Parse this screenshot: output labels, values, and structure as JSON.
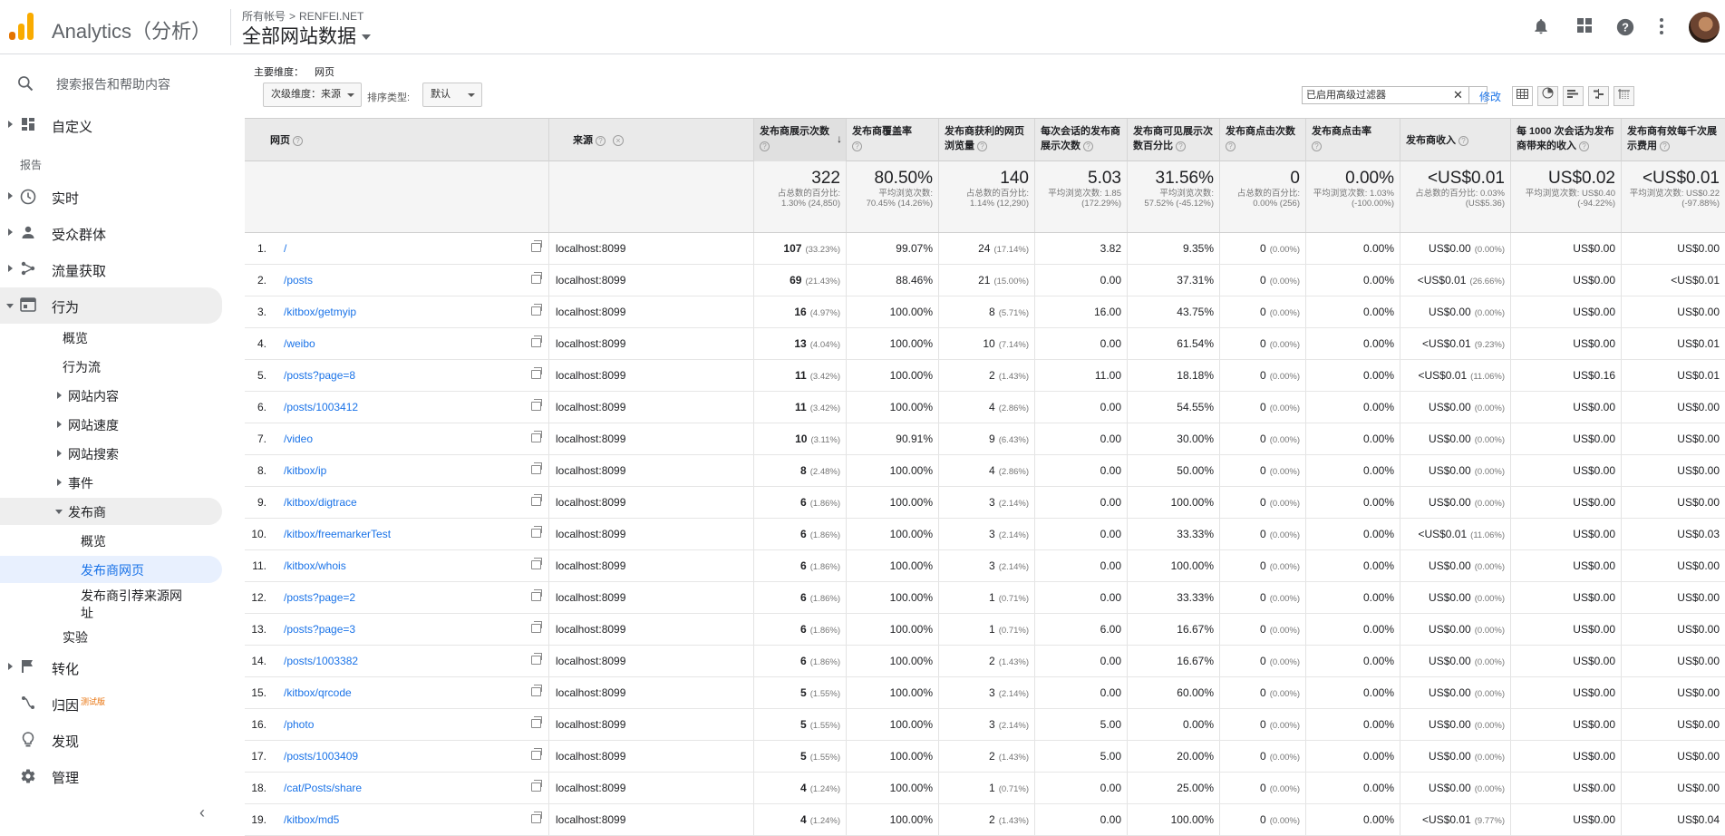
{
  "app": {
    "title": "Analytics（分析）"
  },
  "account": {
    "crumb_root": "所有帐号",
    "crumb_sep": ">",
    "crumb_account": "RENFEI.NET",
    "property": "全部网站数据"
  },
  "sidebar": {
    "search_placeholder": "搜索报告和帮助内容",
    "custom": "自定义",
    "reports_label": "报告",
    "realtime": "实时",
    "audience": "受众群体",
    "acquisition": "流量获取",
    "behavior": "行为",
    "overview": "概览",
    "flow": "行为流",
    "content": "网站内容",
    "speed": "网站速度",
    "search": "网站搜索",
    "events": "事件",
    "publisher": "发布商",
    "pub_overview": "概览",
    "pub_pages": "发布商网页",
    "pub_referrers": "发布商引荐来源网址",
    "experiments": "实验",
    "conversions": "转化",
    "attribution": "归因",
    "attribution_beta": "测试版",
    "discover": "发现",
    "admin": "管理"
  },
  "main": {
    "primary_dim_label": "主要维度：",
    "primary_dim_value": "网页",
    "secondary_dim": "次级维度：来源",
    "sort_type_label": "排序类型:",
    "sort_type_value": "默认",
    "filter_text": "已启用高级过滤器",
    "filter_clear": "✕",
    "modify": "修改"
  },
  "table": {
    "headers": {
      "page": "网页",
      "source": "来源",
      "impressions": "发布商展示次数",
      "coverage": "发布商覆盖率",
      "monetized": "发布商获利的网页浏览量",
      "imp_per_session": "每次会话的发布商展示次数",
      "viewable": "发布商可见展示次数百分比",
      "clicks": "发布商点击次数",
      "ctr": "发布商点击率",
      "revenue": "发布商收入",
      "rev_per_1000": "每 1000 次会话为发布商带来的收入",
      "ecpm": "发布商有效每千次展示费用"
    },
    "totals": {
      "impressions": "322",
      "impressions_sub": "占总数的百分比: 1.30% (24,850)",
      "coverage": "80.50%",
      "coverage_sub": "平均浏览次数: 70.45% (14.26%)",
      "monetized": "140",
      "monetized_sub": "占总数的百分比: 1.14% (12,290)",
      "imp_per_session": "5.03",
      "imp_per_session_sub": "平均浏览次数: 1.85 (172.29%)",
      "viewable": "31.56%",
      "viewable_sub": "平均浏览次数: 57.52% (-45.12%)",
      "clicks": "0",
      "clicks_sub": "占总数的百分比: 0.00% (256)",
      "ctr": "0.00%",
      "ctr_sub": "平均浏览次数: 1.03% (-100.00%)",
      "revenue": "<US$0.01",
      "revenue_sub": "占总数的百分比: 0.03% (US$5.36)",
      "rev_per_1000": "US$0.02",
      "rev_per_1000_sub": "平均浏览次数: US$0.40 (-94.22%)",
      "ecpm": "<US$0.01",
      "ecpm_sub": "平均浏览次数: US$0.22 (-97.88%)"
    },
    "rows": [
      {
        "idx": "1.",
        "page": "/",
        "source": "localhost:8099",
        "imp": "107",
        "imp_pct": "(33.23%)",
        "cov": "99.07%",
        "mon": "24",
        "mon_pct": "(17.14%)",
        "ips": "3.82",
        "view": "9.35%",
        "clk": "0",
        "clk_pct": "(0.00%)",
        "ctr": "0.00%",
        "rev": "US$0.00",
        "rev_pct": "(0.00%)",
        "r1000": "US$0.00",
        "ecpm": "US$0.00"
      },
      {
        "idx": "2.",
        "page": "/posts",
        "source": "localhost:8099",
        "imp": "69",
        "imp_pct": "(21.43%)",
        "cov": "88.46%",
        "mon": "21",
        "mon_pct": "(15.00%)",
        "ips": "0.00",
        "view": "37.31%",
        "clk": "0",
        "clk_pct": "(0.00%)",
        "ctr": "0.00%",
        "rev": "<US$0.01",
        "rev_pct": "(26.66%)",
        "r1000": "US$0.00",
        "ecpm": "<US$0.01"
      },
      {
        "idx": "3.",
        "page": "/kitbox/getmyip",
        "source": "localhost:8099",
        "imp": "16",
        "imp_pct": "(4.97%)",
        "cov": "100.00%",
        "mon": "8",
        "mon_pct": "(5.71%)",
        "ips": "16.00",
        "view": "43.75%",
        "clk": "0",
        "clk_pct": "(0.00%)",
        "ctr": "0.00%",
        "rev": "US$0.00",
        "rev_pct": "(0.00%)",
        "r1000": "US$0.00",
        "ecpm": "US$0.00"
      },
      {
        "idx": "4.",
        "page": "/weibo",
        "source": "localhost:8099",
        "imp": "13",
        "imp_pct": "(4.04%)",
        "cov": "100.00%",
        "mon": "10",
        "mon_pct": "(7.14%)",
        "ips": "0.00",
        "view": "61.54%",
        "clk": "0",
        "clk_pct": "(0.00%)",
        "ctr": "0.00%",
        "rev": "<US$0.01",
        "rev_pct": "(9.23%)",
        "r1000": "US$0.00",
        "ecpm": "US$0.01"
      },
      {
        "idx": "5.",
        "page": "/posts?page=8",
        "source": "localhost:8099",
        "imp": "11",
        "imp_pct": "(3.42%)",
        "cov": "100.00%",
        "mon": "2",
        "mon_pct": "(1.43%)",
        "ips": "11.00",
        "view": "18.18%",
        "clk": "0",
        "clk_pct": "(0.00%)",
        "ctr": "0.00%",
        "rev": "<US$0.01",
        "rev_pct": "(11.06%)",
        "r1000": "US$0.16",
        "ecpm": "US$0.01"
      },
      {
        "idx": "6.",
        "page": "/posts/1003412",
        "source": "localhost:8099",
        "imp": "11",
        "imp_pct": "(3.42%)",
        "cov": "100.00%",
        "mon": "4",
        "mon_pct": "(2.86%)",
        "ips": "0.00",
        "view": "54.55%",
        "clk": "0",
        "clk_pct": "(0.00%)",
        "ctr": "0.00%",
        "rev": "US$0.00",
        "rev_pct": "(0.00%)",
        "r1000": "US$0.00",
        "ecpm": "US$0.00"
      },
      {
        "idx": "7.",
        "page": "/video",
        "source": "localhost:8099",
        "imp": "10",
        "imp_pct": "(3.11%)",
        "cov": "90.91%",
        "mon": "9",
        "mon_pct": "(6.43%)",
        "ips": "0.00",
        "view": "30.00%",
        "clk": "0",
        "clk_pct": "(0.00%)",
        "ctr": "0.00%",
        "rev": "US$0.00",
        "rev_pct": "(0.00%)",
        "r1000": "US$0.00",
        "ecpm": "US$0.00"
      },
      {
        "idx": "8.",
        "page": "/kitbox/ip",
        "source": "localhost:8099",
        "imp": "8",
        "imp_pct": "(2.48%)",
        "cov": "100.00%",
        "mon": "4",
        "mon_pct": "(2.86%)",
        "ips": "0.00",
        "view": "50.00%",
        "clk": "0",
        "clk_pct": "(0.00%)",
        "ctr": "0.00%",
        "rev": "US$0.00",
        "rev_pct": "(0.00%)",
        "r1000": "US$0.00",
        "ecpm": "US$0.00"
      },
      {
        "idx": "9.",
        "page": "/kitbox/digtrace",
        "source": "localhost:8099",
        "imp": "6",
        "imp_pct": "(1.86%)",
        "cov": "100.00%",
        "mon": "3",
        "mon_pct": "(2.14%)",
        "ips": "0.00",
        "view": "100.00%",
        "clk": "0",
        "clk_pct": "(0.00%)",
        "ctr": "0.00%",
        "rev": "US$0.00",
        "rev_pct": "(0.00%)",
        "r1000": "US$0.00",
        "ecpm": "US$0.00"
      },
      {
        "idx": "10.",
        "page": "/kitbox/freemarkerTest",
        "source": "localhost:8099",
        "imp": "6",
        "imp_pct": "(1.86%)",
        "cov": "100.00%",
        "mon": "3",
        "mon_pct": "(2.14%)",
        "ips": "0.00",
        "view": "33.33%",
        "clk": "0",
        "clk_pct": "(0.00%)",
        "ctr": "0.00%",
        "rev": "<US$0.01",
        "rev_pct": "(11.06%)",
        "r1000": "US$0.00",
        "ecpm": "US$0.03"
      },
      {
        "idx": "11.",
        "page": "/kitbox/whois",
        "source": "localhost:8099",
        "imp": "6",
        "imp_pct": "(1.86%)",
        "cov": "100.00%",
        "mon": "3",
        "mon_pct": "(2.14%)",
        "ips": "0.00",
        "view": "100.00%",
        "clk": "0",
        "clk_pct": "(0.00%)",
        "ctr": "0.00%",
        "rev": "US$0.00",
        "rev_pct": "(0.00%)",
        "r1000": "US$0.00",
        "ecpm": "US$0.00"
      },
      {
        "idx": "12.",
        "page": "/posts?page=2",
        "source": "localhost:8099",
        "imp": "6",
        "imp_pct": "(1.86%)",
        "cov": "100.00%",
        "mon": "1",
        "mon_pct": "(0.71%)",
        "ips": "0.00",
        "view": "33.33%",
        "clk": "0",
        "clk_pct": "(0.00%)",
        "ctr": "0.00%",
        "rev": "US$0.00",
        "rev_pct": "(0.00%)",
        "r1000": "US$0.00",
        "ecpm": "US$0.00"
      },
      {
        "idx": "13.",
        "page": "/posts?page=3",
        "source": "localhost:8099",
        "imp": "6",
        "imp_pct": "(1.86%)",
        "cov": "100.00%",
        "mon": "1",
        "mon_pct": "(0.71%)",
        "ips": "6.00",
        "view": "16.67%",
        "clk": "0",
        "clk_pct": "(0.00%)",
        "ctr": "0.00%",
        "rev": "US$0.00",
        "rev_pct": "(0.00%)",
        "r1000": "US$0.00",
        "ecpm": "US$0.00"
      },
      {
        "idx": "14.",
        "page": "/posts/1003382",
        "source": "localhost:8099",
        "imp": "6",
        "imp_pct": "(1.86%)",
        "cov": "100.00%",
        "mon": "2",
        "mon_pct": "(1.43%)",
        "ips": "0.00",
        "view": "16.67%",
        "clk": "0",
        "clk_pct": "(0.00%)",
        "ctr": "0.00%",
        "rev": "US$0.00",
        "rev_pct": "(0.00%)",
        "r1000": "US$0.00",
        "ecpm": "US$0.00"
      },
      {
        "idx": "15.",
        "page": "/kitbox/qrcode",
        "source": "localhost:8099",
        "imp": "5",
        "imp_pct": "(1.55%)",
        "cov": "100.00%",
        "mon": "3",
        "mon_pct": "(2.14%)",
        "ips": "0.00",
        "view": "60.00%",
        "clk": "0",
        "clk_pct": "(0.00%)",
        "ctr": "0.00%",
        "rev": "US$0.00",
        "rev_pct": "(0.00%)",
        "r1000": "US$0.00",
        "ecpm": "US$0.00"
      },
      {
        "idx": "16.",
        "page": "/photo",
        "source": "localhost:8099",
        "imp": "5",
        "imp_pct": "(1.55%)",
        "cov": "100.00%",
        "mon": "3",
        "mon_pct": "(2.14%)",
        "ips": "5.00",
        "view": "0.00%",
        "clk": "0",
        "clk_pct": "(0.00%)",
        "ctr": "0.00%",
        "rev": "US$0.00",
        "rev_pct": "(0.00%)",
        "r1000": "US$0.00",
        "ecpm": "US$0.00"
      },
      {
        "idx": "17.",
        "page": "/posts/1003409",
        "source": "localhost:8099",
        "imp": "5",
        "imp_pct": "(1.55%)",
        "cov": "100.00%",
        "mon": "2",
        "mon_pct": "(1.43%)",
        "ips": "5.00",
        "view": "20.00%",
        "clk": "0",
        "clk_pct": "(0.00%)",
        "ctr": "0.00%",
        "rev": "US$0.00",
        "rev_pct": "(0.00%)",
        "r1000": "US$0.00",
        "ecpm": "US$0.00"
      },
      {
        "idx": "18.",
        "page": "/cat/Posts/share",
        "source": "localhost:8099",
        "imp": "4",
        "imp_pct": "(1.24%)",
        "cov": "100.00%",
        "mon": "1",
        "mon_pct": "(0.71%)",
        "ips": "0.00",
        "view": "25.00%",
        "clk": "0",
        "clk_pct": "(0.00%)",
        "ctr": "0.00%",
        "rev": "US$0.00",
        "rev_pct": "(0.00%)",
        "r1000": "US$0.00",
        "ecpm": "US$0.00"
      },
      {
        "idx": "19.",
        "page": "/kitbox/md5",
        "source": "localhost:8099",
        "imp": "4",
        "imp_pct": "(1.24%)",
        "cov": "100.00%",
        "mon": "2",
        "mon_pct": "(1.43%)",
        "ips": "0.00",
        "view": "100.00%",
        "clk": "0",
        "clk_pct": "(0.00%)",
        "ctr": "0.00%",
        "rev": "<US$0.01",
        "rev_pct": "(9.77%)",
        "r1000": "US$0.00",
        "ecpm": "US$0.04"
      }
    ]
  }
}
